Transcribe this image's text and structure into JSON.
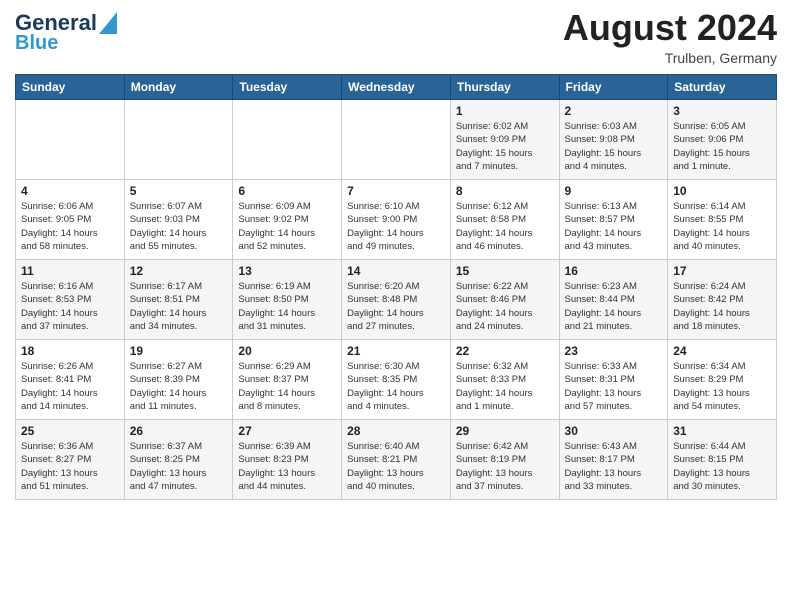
{
  "header": {
    "logo_general": "General",
    "logo_blue": "Blue",
    "month_year": "August 2024",
    "location": "Trulben, Germany"
  },
  "days_of_week": [
    "Sunday",
    "Monday",
    "Tuesday",
    "Wednesday",
    "Thursday",
    "Friday",
    "Saturday"
  ],
  "weeks": [
    [
      {
        "day": "",
        "info": ""
      },
      {
        "day": "",
        "info": ""
      },
      {
        "day": "",
        "info": ""
      },
      {
        "day": "",
        "info": ""
      },
      {
        "day": "1",
        "info": "Sunrise: 6:02 AM\nSunset: 9:09 PM\nDaylight: 15 hours\nand 7 minutes."
      },
      {
        "day": "2",
        "info": "Sunrise: 6:03 AM\nSunset: 9:08 PM\nDaylight: 15 hours\nand 4 minutes."
      },
      {
        "day": "3",
        "info": "Sunrise: 6:05 AM\nSunset: 9:06 PM\nDaylight: 15 hours\nand 1 minute."
      }
    ],
    [
      {
        "day": "4",
        "info": "Sunrise: 6:06 AM\nSunset: 9:05 PM\nDaylight: 14 hours\nand 58 minutes."
      },
      {
        "day": "5",
        "info": "Sunrise: 6:07 AM\nSunset: 9:03 PM\nDaylight: 14 hours\nand 55 minutes."
      },
      {
        "day": "6",
        "info": "Sunrise: 6:09 AM\nSunset: 9:02 PM\nDaylight: 14 hours\nand 52 minutes."
      },
      {
        "day": "7",
        "info": "Sunrise: 6:10 AM\nSunset: 9:00 PM\nDaylight: 14 hours\nand 49 minutes."
      },
      {
        "day": "8",
        "info": "Sunrise: 6:12 AM\nSunset: 8:58 PM\nDaylight: 14 hours\nand 46 minutes."
      },
      {
        "day": "9",
        "info": "Sunrise: 6:13 AM\nSunset: 8:57 PM\nDaylight: 14 hours\nand 43 minutes."
      },
      {
        "day": "10",
        "info": "Sunrise: 6:14 AM\nSunset: 8:55 PM\nDaylight: 14 hours\nand 40 minutes."
      }
    ],
    [
      {
        "day": "11",
        "info": "Sunrise: 6:16 AM\nSunset: 8:53 PM\nDaylight: 14 hours\nand 37 minutes."
      },
      {
        "day": "12",
        "info": "Sunrise: 6:17 AM\nSunset: 8:51 PM\nDaylight: 14 hours\nand 34 minutes."
      },
      {
        "day": "13",
        "info": "Sunrise: 6:19 AM\nSunset: 8:50 PM\nDaylight: 14 hours\nand 31 minutes."
      },
      {
        "day": "14",
        "info": "Sunrise: 6:20 AM\nSunset: 8:48 PM\nDaylight: 14 hours\nand 27 minutes."
      },
      {
        "day": "15",
        "info": "Sunrise: 6:22 AM\nSunset: 8:46 PM\nDaylight: 14 hours\nand 24 minutes."
      },
      {
        "day": "16",
        "info": "Sunrise: 6:23 AM\nSunset: 8:44 PM\nDaylight: 14 hours\nand 21 minutes."
      },
      {
        "day": "17",
        "info": "Sunrise: 6:24 AM\nSunset: 8:42 PM\nDaylight: 14 hours\nand 18 minutes."
      }
    ],
    [
      {
        "day": "18",
        "info": "Sunrise: 6:26 AM\nSunset: 8:41 PM\nDaylight: 14 hours\nand 14 minutes."
      },
      {
        "day": "19",
        "info": "Sunrise: 6:27 AM\nSunset: 8:39 PM\nDaylight: 14 hours\nand 11 minutes."
      },
      {
        "day": "20",
        "info": "Sunrise: 6:29 AM\nSunset: 8:37 PM\nDaylight: 14 hours\nand 8 minutes."
      },
      {
        "day": "21",
        "info": "Sunrise: 6:30 AM\nSunset: 8:35 PM\nDaylight: 14 hours\nand 4 minutes."
      },
      {
        "day": "22",
        "info": "Sunrise: 6:32 AM\nSunset: 8:33 PM\nDaylight: 14 hours\nand 1 minute."
      },
      {
        "day": "23",
        "info": "Sunrise: 6:33 AM\nSunset: 8:31 PM\nDaylight: 13 hours\nand 57 minutes."
      },
      {
        "day": "24",
        "info": "Sunrise: 6:34 AM\nSunset: 8:29 PM\nDaylight: 13 hours\nand 54 minutes."
      }
    ],
    [
      {
        "day": "25",
        "info": "Sunrise: 6:36 AM\nSunset: 8:27 PM\nDaylight: 13 hours\nand 51 minutes."
      },
      {
        "day": "26",
        "info": "Sunrise: 6:37 AM\nSunset: 8:25 PM\nDaylight: 13 hours\nand 47 minutes."
      },
      {
        "day": "27",
        "info": "Sunrise: 6:39 AM\nSunset: 8:23 PM\nDaylight: 13 hours\nand 44 minutes."
      },
      {
        "day": "28",
        "info": "Sunrise: 6:40 AM\nSunset: 8:21 PM\nDaylight: 13 hours\nand 40 minutes."
      },
      {
        "day": "29",
        "info": "Sunrise: 6:42 AM\nSunset: 8:19 PM\nDaylight: 13 hours\nand 37 minutes."
      },
      {
        "day": "30",
        "info": "Sunrise: 6:43 AM\nSunset: 8:17 PM\nDaylight: 13 hours\nand 33 minutes."
      },
      {
        "day": "31",
        "info": "Sunrise: 6:44 AM\nSunset: 8:15 PM\nDaylight: 13 hours\nand 30 minutes."
      }
    ]
  ]
}
